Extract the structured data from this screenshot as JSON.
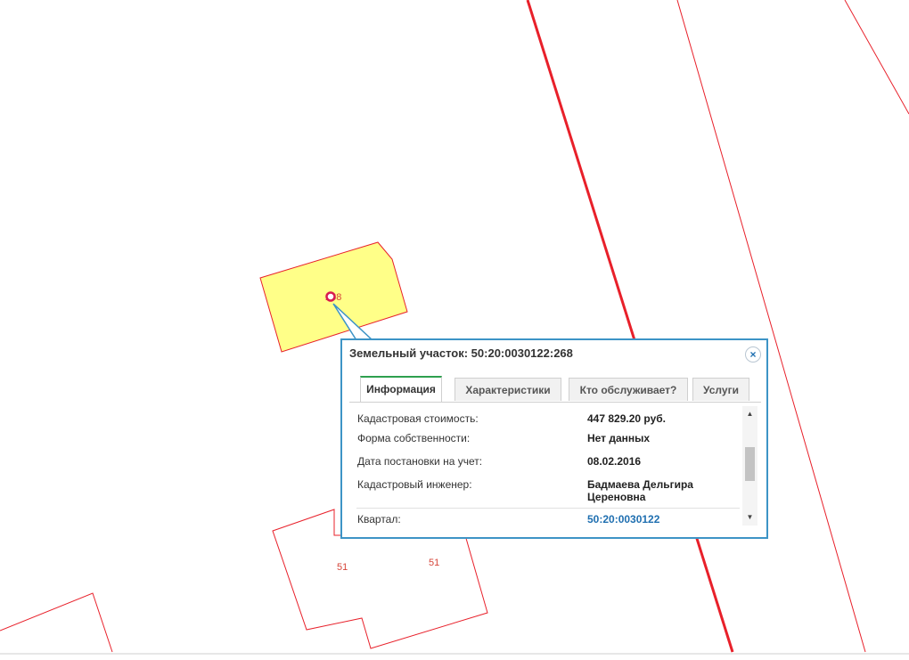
{
  "map": {
    "parcel_labels": [
      "268",
      "51",
      "51"
    ],
    "colors": {
      "boundary": "#e8202a",
      "highlight_fill": "#ffff88",
      "highlight_stroke": "#e8202a"
    }
  },
  "popup": {
    "title": "Земельный участок: 50:20:0030122:268",
    "close_icon": "×",
    "tabs": [
      {
        "label": "Информация",
        "active": true
      },
      {
        "label": "Характеристики",
        "active": false
      },
      {
        "label": "Кто обслуживает?",
        "active": false
      },
      {
        "label": "Услуги",
        "active": false
      }
    ],
    "rows": [
      {
        "label": "Кадастровая стоимость:",
        "value": "447 829.20 руб."
      },
      {
        "label": "Форма собственности:",
        "value": "Нет данных"
      },
      {
        "label": "Дата постановки на учет:",
        "value": "08.02.2016"
      },
      {
        "label": "Кадастровый инженер:",
        "value": "Бадмаева Дельгира Цереновна"
      },
      {
        "label": "Квартал:",
        "value": "50:20:0030122"
      }
    ],
    "accent_color": "#3d94c6",
    "active_tab_color": "#2ea04f"
  }
}
